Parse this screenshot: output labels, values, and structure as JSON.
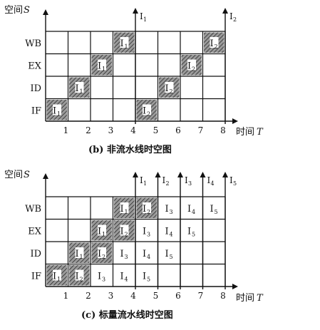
{
  "diagram_b": {
    "y_axis_label": "空间",
    "y_axis_var": "S",
    "x_axis_label": "时间",
    "x_axis_var": "T",
    "stages": [
      "IF",
      "ID",
      "EX",
      "WB"
    ],
    "time_ticks": [
      "1",
      "2",
      "3",
      "4",
      "5",
      "6",
      "7",
      "8"
    ],
    "instruction_arrows": [
      {
        "at": 4,
        "label": "I",
        "sub": "1"
      },
      {
        "at": 8,
        "label": "I",
        "sub": "2"
      }
    ],
    "occupied_cells": [
      {
        "stage": "IF",
        "t": 1,
        "label": "I",
        "sub": "1",
        "style": "hatched"
      },
      {
        "stage": "ID",
        "t": 2,
        "label": "I",
        "sub": "1",
        "style": "hatched"
      },
      {
        "stage": "EX",
        "t": 3,
        "label": "I",
        "sub": "1",
        "style": "hatched"
      },
      {
        "stage": "WB",
        "t": 4,
        "label": "I",
        "sub": "1",
        "style": "hatched"
      },
      {
        "stage": "IF",
        "t": 5,
        "label": "I",
        "sub": "2",
        "style": "hatched"
      },
      {
        "stage": "ID",
        "t": 6,
        "label": "I",
        "sub": "2",
        "style": "hatched"
      },
      {
        "stage": "EX",
        "t": 7,
        "label": "I",
        "sub": "2",
        "style": "hatched"
      },
      {
        "stage": "WB",
        "t": 8,
        "label": "I",
        "sub": "2",
        "style": "hatched"
      }
    ],
    "caption": "(b) 非流水线时空图"
  },
  "diagram_c": {
    "y_axis_label": "空间",
    "y_axis_var": "S",
    "x_axis_label": "时间",
    "x_axis_var": "T",
    "stages": [
      "IF",
      "ID",
      "EX",
      "WB"
    ],
    "time_ticks": [
      "1",
      "2",
      "3",
      "4",
      "5",
      "6",
      "7",
      "8"
    ],
    "instruction_arrows": [
      {
        "at": 4,
        "label": "I",
        "sub": "1"
      },
      {
        "at": 5,
        "label": "I",
        "sub": "2"
      },
      {
        "at": 6,
        "label": "I",
        "sub": "3"
      },
      {
        "at": 7,
        "label": "I",
        "sub": "4"
      },
      {
        "at": 8,
        "label": "I",
        "sub": "5"
      }
    ],
    "occupied_cells": [
      {
        "stage": "IF",
        "t": 1,
        "label": "I",
        "sub": "1",
        "style": "hatched"
      },
      {
        "stage": "IF",
        "t": 2,
        "label": "I",
        "sub": "2",
        "style": "hatched"
      },
      {
        "stage": "IF",
        "t": 3,
        "label": "I",
        "sub": "3",
        "style": "plain"
      },
      {
        "stage": "IF",
        "t": 4,
        "label": "I",
        "sub": "4",
        "style": "plain"
      },
      {
        "stage": "IF",
        "t": 5,
        "label": "I",
        "sub": "5",
        "style": "plain"
      },
      {
        "stage": "ID",
        "t": 2,
        "label": "I",
        "sub": "1",
        "style": "hatched"
      },
      {
        "stage": "ID",
        "t": 3,
        "label": "I",
        "sub": "2",
        "style": "hatched"
      },
      {
        "stage": "ID",
        "t": 4,
        "label": "I",
        "sub": "3",
        "style": "plain"
      },
      {
        "stage": "ID",
        "t": 5,
        "label": "I",
        "sub": "4",
        "style": "plain"
      },
      {
        "stage": "ID",
        "t": 6,
        "label": "I",
        "sub": "5",
        "style": "plain"
      },
      {
        "stage": "EX",
        "t": 3,
        "label": "I",
        "sub": "1",
        "style": "hatched"
      },
      {
        "stage": "EX",
        "t": 4,
        "label": "I",
        "sub": "2",
        "style": "hatched"
      },
      {
        "stage": "EX",
        "t": 5,
        "label": "I",
        "sub": "3",
        "style": "plain"
      },
      {
        "stage": "EX",
        "t": 6,
        "label": "I",
        "sub": "4",
        "style": "plain"
      },
      {
        "stage": "EX",
        "t": 7,
        "label": "I",
        "sub": "5",
        "style": "plain"
      },
      {
        "stage": "WB",
        "t": 4,
        "label": "I",
        "sub": "1",
        "style": "hatched"
      },
      {
        "stage": "WB",
        "t": 5,
        "label": "I",
        "sub": "2",
        "style": "hatched"
      },
      {
        "stage": "WB",
        "t": 6,
        "label": "I",
        "sub": "3",
        "style": "plain"
      },
      {
        "stage": "WB",
        "t": 7,
        "label": "I",
        "sub": "4",
        "style": "plain"
      },
      {
        "stage": "WB",
        "t": 8,
        "label": "I",
        "sub": "5",
        "style": "plain"
      }
    ],
    "caption": "(c) 标量流水线时空图"
  },
  "colors": {
    "ink": "#111111",
    "hatch_fill": "#8a8a8a",
    "paper": "#ffffff"
  }
}
